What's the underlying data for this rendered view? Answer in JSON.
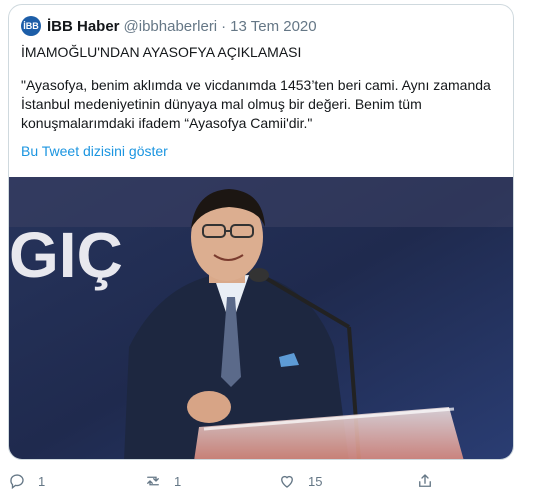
{
  "tweet": {
    "author_name": "İBB Haber",
    "avatar_text": "İBB",
    "handle": "@ibbhaberleri",
    "separator": "·",
    "date": "13 Tem 2020",
    "headline": "İMAMOĞLU'NDAN AYASOFYA AÇIKLAMASI",
    "quote": "\"Ayasofya, benim aklımda ve vicdanımda 1453’ten beri cami. Aynı zamanda İstanbul medeniyetinin dünyaya mal olmuş bir değeri. Benim tüm konuşmalarımdaki ifadem “Ayasofya Camii'dir.\"",
    "thread_link": "Bu Tweet dizisini göster",
    "photo_text": "GIÇ"
  },
  "actions": {
    "reply_count": "1",
    "retweet_count": "1",
    "like_count": "15"
  },
  "colors": {
    "link": "#1b95e0",
    "muted": "#657786",
    "border": "#cfd9de",
    "avatar": "#1d5ea8"
  },
  "icons": [
    "reply-icon",
    "retweet-icon",
    "like-icon",
    "share-icon"
  ]
}
